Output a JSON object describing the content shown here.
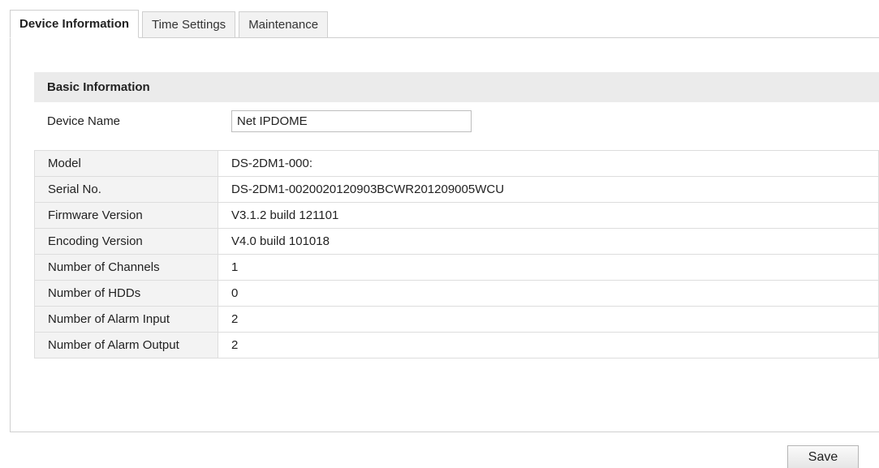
{
  "tabs": [
    {
      "label": "Device Information",
      "active": true
    },
    {
      "label": "Time Settings",
      "active": false
    },
    {
      "label": "Maintenance",
      "active": false
    }
  ],
  "basic_info": {
    "header": "Basic Information",
    "device_name_label": "Device Name",
    "device_name_value": "Net IPDOME"
  },
  "info_rows": [
    {
      "label": "Model",
      "value": "DS-2DM1-000:"
    },
    {
      "label": "Serial No.",
      "value": "DS-2DM1-0020020120903BCWR201209005WCU"
    },
    {
      "label": "Firmware Version",
      "value": "V3.1.2 build 121101"
    },
    {
      "label": "Encoding Version",
      "value": "V4.0 build 101018"
    },
    {
      "label": "Number of Channels",
      "value": "1"
    },
    {
      "label": "Number of HDDs",
      "value": "0"
    },
    {
      "label": "Number of Alarm Input",
      "value": "2"
    },
    {
      "label": "Number of Alarm Output",
      "value": "2"
    }
  ],
  "actions": {
    "save_label": "Save"
  },
  "colors": {
    "section_header_bg": "#ebebeb",
    "label_cell_bg": "#f3f3f3",
    "border": "#dddddd"
  }
}
